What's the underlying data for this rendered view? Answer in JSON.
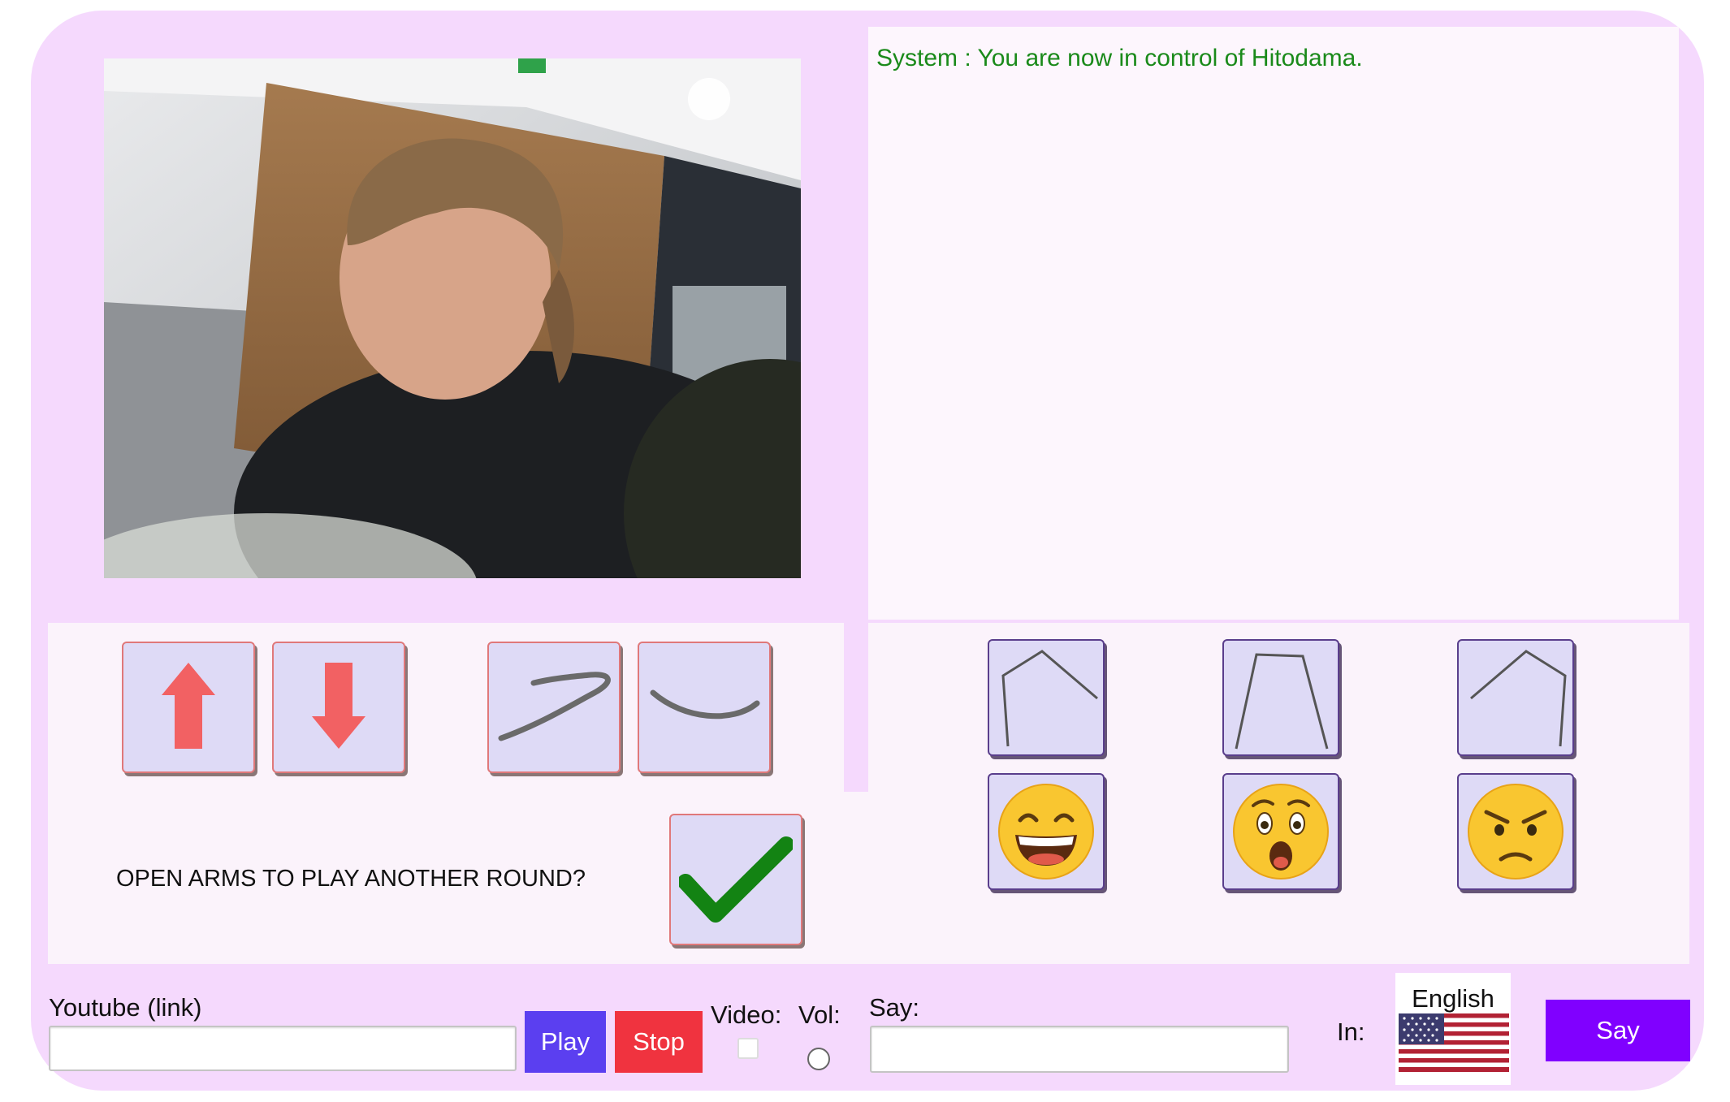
{
  "chat": {
    "messages": [
      {
        "text": "System : You are now in control of Hitodama.",
        "color": "#1a8a1a"
      }
    ]
  },
  "controls": {
    "arm_buttons": [
      "arrow-up-icon",
      "arrow-down-icon",
      "curve-up-icon",
      "curve-smile-icon"
    ],
    "posture_buttons": [
      "pose-left-icon",
      "pose-trapezoid-icon",
      "pose-right-icon"
    ],
    "emotion_buttons": [
      "grinning-face-icon",
      "surprised-face-icon",
      "angry-face-icon"
    ],
    "prompt": "OPEN ARMS TO PLAY ANOTHER ROUND?",
    "confirm_icon": "checkmark-icon"
  },
  "youtube": {
    "label": "Youtube (link)",
    "value": "",
    "play_label": "Play",
    "stop_label": "Stop"
  },
  "video_label": "Video:",
  "vol_label": "Vol:",
  "say": {
    "label": "Say:",
    "value": "",
    "in_label": "In:",
    "language": "English",
    "flag_icon": "us-flag-icon",
    "say_button": "Say"
  },
  "colors": {
    "frame": "#f5d9fd",
    "panel": "#fbf3fb",
    "play": "#5b3ff0",
    "stop": "#f0333f",
    "say": "#8000ff",
    "system_text": "#1a8a1a"
  }
}
